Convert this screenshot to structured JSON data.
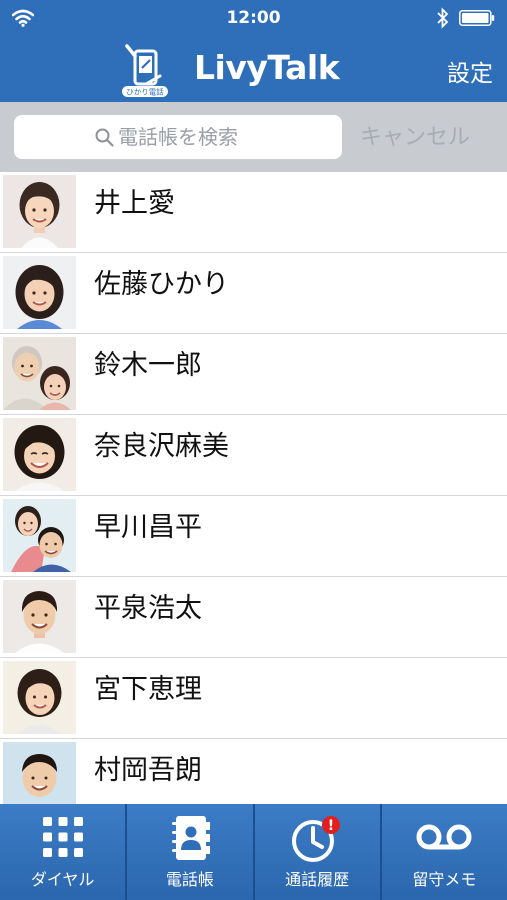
{
  "status": {
    "time": "12:00"
  },
  "header": {
    "brand": "LivyTalk",
    "logo_caption": "ひかり電話",
    "settings_label": "設定"
  },
  "search": {
    "placeholder": "電話帳を検索",
    "cancel_label": "キャンセル"
  },
  "contacts": [
    {
      "name": "井上愛",
      "avatar": "woman-portrait"
    },
    {
      "name": "佐藤ひかり",
      "avatar": "woman-portrait"
    },
    {
      "name": "鈴木一郎",
      "avatar": "elderly-couple-portrait"
    },
    {
      "name": "奈良沢麻美",
      "avatar": "woman-portrait"
    },
    {
      "name": "早川昌平",
      "avatar": "father-child-portrait"
    },
    {
      "name": "平泉浩太",
      "avatar": "man-portrait"
    },
    {
      "name": "宮下恵理",
      "avatar": "woman-portrait"
    },
    {
      "name": "村岡吾朗",
      "avatar": "boy-portrait"
    }
  ],
  "tabs": [
    {
      "label": "ダイヤル",
      "icon": "dialpad-icon"
    },
    {
      "label": "電話帳",
      "icon": "phonebook-icon"
    },
    {
      "label": "通話履歴",
      "icon": "call-history-icon",
      "badge": "!"
    },
    {
      "label": "留守メモ",
      "icon": "voicemail-icon"
    }
  ],
  "colors": {
    "bar_blue": "#2f6fb9",
    "search_bg": "#c8cbd0",
    "badge_red": "#e02020"
  }
}
